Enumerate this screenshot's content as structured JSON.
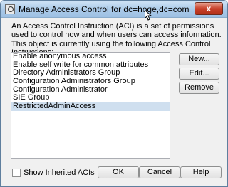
{
  "window": {
    "title": "Manage Access Control for dc=hoge,dc=com",
    "close_label": "x"
  },
  "description": "An Access Control Instruction (ACI) is a set of permissions used to control how and when users can access information. This object is currently using the following Access Control Instructions:",
  "aci_list": {
    "items": [
      "Enable anonymous access",
      "Enable self write for common attributes",
      "Directory Administrators Group",
      "Configuration Administrators Group",
      "Configuration Administrator",
      "SIE Group",
      "RestrictedAdminAccess"
    ],
    "selected": "RestrictedAdminAccess"
  },
  "side_buttons": {
    "new_label": "New...",
    "edit_label": "Edit...",
    "remove_label": "Remove"
  },
  "footer": {
    "show_inherited_label": "Show Inherited ACIs",
    "show_inherited_checked": false,
    "ok_label": "OK",
    "cancel_label": "Cancel",
    "help_label": "Help"
  }
}
